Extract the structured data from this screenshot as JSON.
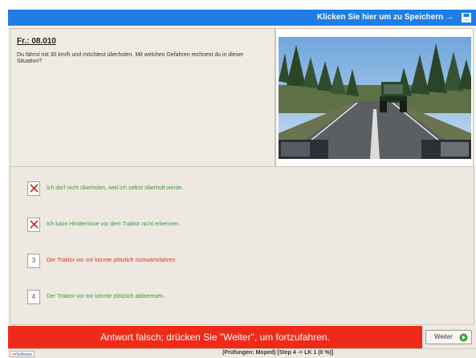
{
  "header": {
    "save_link": "Klicken Sie hier um zu Speichern →",
    "save_icon": "floppy-disk-icon",
    "color": "#1f7de6"
  },
  "question": {
    "number": "Fr.: 08.010",
    "text": "Du fährst mit 30 km/h und möchtest überholen. Mit welchen Gefahren rechnest du in dieser Situation?"
  },
  "image": {
    "icon": "road-scene-tractor-image"
  },
  "answers": [
    {
      "marker": "X",
      "state": "wrong-selected",
      "text": "Ich darf nicht überholen, weil ich selbst überholt werde.",
      "color": "#3c9a3c"
    },
    {
      "marker": "X",
      "state": "wrong-selected",
      "text": "Ich kann Hindernisse vor dem Traktor nicht erkennen.",
      "color": "#3c9a3c"
    },
    {
      "marker": "3",
      "state": "correct-missed",
      "text": "Der Traktor vor mir könnte plötzlich rückwärtsfahren.",
      "color": "#e0302a"
    },
    {
      "marker": "4",
      "state": "unselected",
      "text": "Der Traktor vor mir könnte plötzlich abbremsen.",
      "color": "#3c9a3c"
    }
  ],
  "feedback": {
    "message": "Antwort falsch; drücken Sie \"Weiter\", um fortzufahren.",
    "color": "#ef2a19"
  },
  "next_button": {
    "label": "Weiter",
    "icon": "green-arrow-right-icon"
  },
  "status": {
    "logo": "Software",
    "text": "(Prüfungen: Moped) [Step 4 -> LK 1 (0 %)]"
  }
}
